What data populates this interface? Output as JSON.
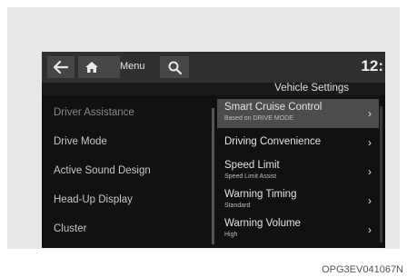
{
  "topbar": {
    "menu_label": "Menu",
    "clock": "12:"
  },
  "title": "Vehicle Settings",
  "left_menu": [
    {
      "label": "Driver Assistance"
    },
    {
      "label": "Drive Mode"
    },
    {
      "label": "Active Sound Design"
    },
    {
      "label": "Head-Up Display"
    },
    {
      "label": "Cluster"
    }
  ],
  "right_menu": [
    {
      "label": "Smart Cruise Control",
      "sub": "Based on DRIVE MODE"
    },
    {
      "label": "Driving Convenience",
      "sub": ""
    },
    {
      "label": "Speed Limit",
      "sub": "Speed Limit Assist"
    },
    {
      "label": "Warning Timing",
      "sub": "Standard"
    },
    {
      "label": "Warning Volume",
      "sub": "High"
    }
  ],
  "chevron": "›",
  "caption": "OPG3EV041067N"
}
